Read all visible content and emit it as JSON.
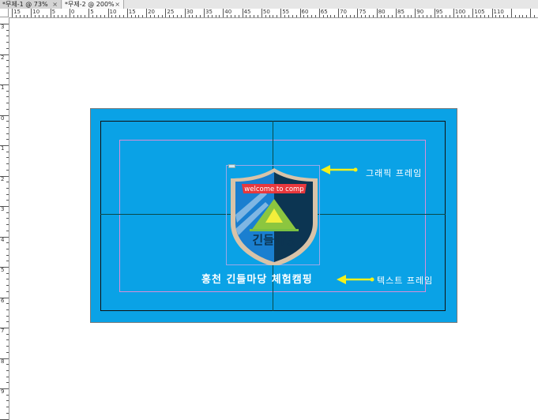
{
  "tabs": [
    {
      "label": "*무제-1 @ 73%",
      "close": "×"
    },
    {
      "label": "*무제-2 @ 200%",
      "close": "×"
    }
  ],
  "ruler": {
    "h_labels": [
      "15",
      "10",
      "5",
      "0",
      "5",
      "10",
      "15",
      "20",
      "25",
      "30",
      "35",
      "40",
      "45",
      "50",
      "55",
      "60",
      "65",
      "70",
      "75",
      "80",
      "85",
      "90",
      "95",
      "100",
      "105",
      "110"
    ],
    "v_labels": [
      "3",
      "2",
      "1",
      "0",
      "1",
      "2",
      "3",
      "4",
      "5",
      "6",
      "7",
      "8",
      "9",
      "10"
    ]
  },
  "badge": {
    "banner_text": "welcome to comp",
    "logo_text": "긴들마당"
  },
  "caption": "홍천 긴들마당 체험캠핑",
  "callouts": {
    "graphic_frame": "그래픽 프레임",
    "text_frame": "텍스트 프레임"
  },
  "colors": {
    "artboard": "#0aa2e6",
    "callout_arrow": "#f4f01a",
    "banner": "#e8383d",
    "shield_dark": "#0c3552",
    "shield_border": "#d9c3a8"
  }
}
